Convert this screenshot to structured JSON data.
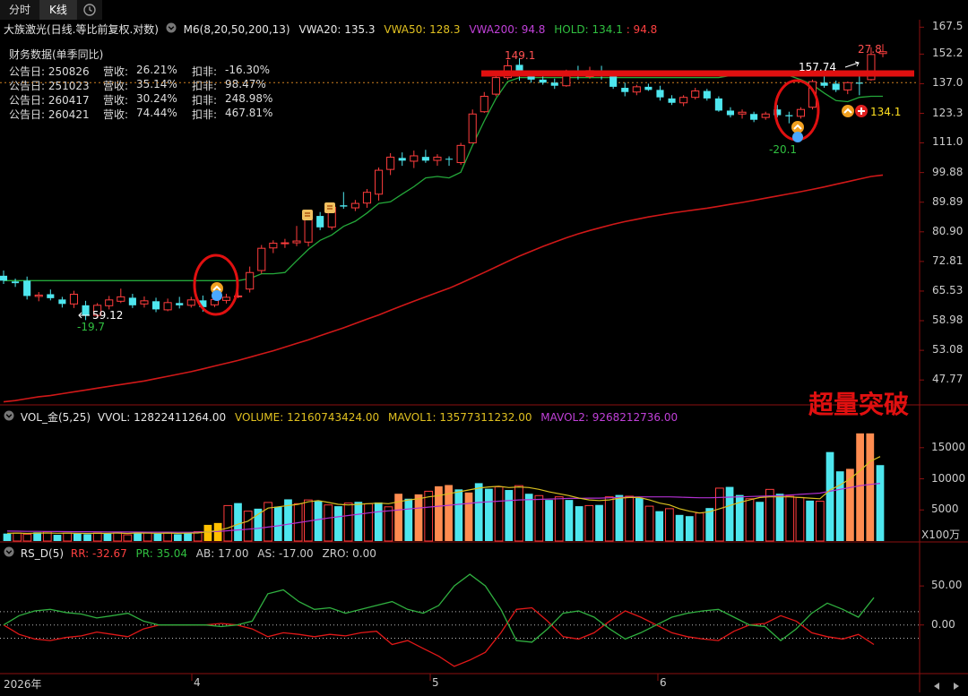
{
  "tabs": [
    {
      "label": "分时",
      "active": false
    },
    {
      "label": "K线",
      "active": true
    }
  ],
  "price_header": {
    "stock": "大族激光(日线.等比前复权.对数)",
    "m6": "M6(8,20,50,200,13)",
    "vwa20": "VWA20: 135.3",
    "vwa50": "VWA50: 128.3",
    "vwa200": "VWA200: 94.8",
    "hold": "HOLD: 134.1",
    "hold2": ": 94.8"
  },
  "financial": {
    "title": "财务数据(单季同比)",
    "rows": [
      {
        "date": "公告日: 250826",
        "rev_label": "营收:",
        "rev": "26.21%",
        "np_label": "扣非:",
        "np": "-16.30%"
      },
      {
        "date": "公告日: 251023",
        "rev_label": "营收:",
        "rev": "35.14%",
        "np_label": "扣非:",
        "np": "98.47%"
      },
      {
        "date": "公告日: 260417",
        "rev_label": "营收:",
        "rev": "30.24%",
        "np_label": "扣非:",
        "np": "248.98%"
      },
      {
        "date": "公告日: 260421",
        "rev_label": "营收:",
        "rev": "74.44%",
        "np_label": "扣非:",
        "np": "467.81%"
      }
    ]
  },
  "price_axis": [
    "167.5",
    "152.2",
    "137.0",
    "123.3",
    "111.0",
    "99.88",
    "89.89",
    "80.90",
    "72.81",
    "65.53",
    "58.98",
    "53.08",
    "47.77"
  ],
  "annotations": {
    "high_price": "149.1",
    "right_high": "157.74",
    "right_pct": "27.8",
    "low_price": "59.12",
    "low_pct": "-19.7",
    "right_low_pct": "-20.1",
    "hold_marker": "134.1",
    "breakout_text": "超量突破"
  },
  "vol_header": {
    "name": "VOL_金(5,25)",
    "vvol": "VVOL: 12822411264.00",
    "volume": "VOLUME: 12160743424.00",
    "mavol1": "MAVOL1: 13577311232.00",
    "mavol2": "MAVOL2: 9268212736.00"
  },
  "vol_axis": [
    "15000",
    "10000",
    "5000"
  ],
  "vol_unit": "X100万",
  "rs_header": {
    "name": "RS_D(5)",
    "rr": "RR: -32.67",
    "pr": "PR: 35.04",
    "ab": "AB: 17.00",
    "as": "AS: -17.00",
    "zro": "ZRO: 0.00"
  },
  "rs_axis": [
    "50.00",
    "0.00"
  ],
  "x_axis": [
    {
      "label": "2026年"
    },
    {
      "label": "4"
    },
    {
      "label": "5"
    },
    {
      "label": "6"
    }
  ],
  "colors": {
    "up": "#ff3d3d",
    "down": "#4ee6ee",
    "ma_green": "#24a83a",
    "ma_red": "#d01818",
    "vol_orange": "#ff8c50",
    "vol_yellow": "#ffc000",
    "mavol1": "#d8c020",
    "mavol2": "#b030d0",
    "annot_red": "#e01010"
  },
  "chart_data": [
    {
      "type": "candlestick",
      "title": "大族激光(日线.等比前复权.对数)",
      "ylim": [
        44,
        172
      ],
      "yscale": "log",
      "candles": [
        [
          69.2,
          70.5,
          67.2,
          68.0
        ],
        [
          67.8,
          68.5,
          66.5,
          67.4
        ],
        [
          68.0,
          69.0,
          63.6,
          64.4
        ],
        [
          64.3,
          65.3,
          63.2,
          64.6
        ],
        [
          64.8,
          65.9,
          63.4,
          63.9
        ],
        [
          63.6,
          64.2,
          61.8,
          62.6
        ],
        [
          62.6,
          65.6,
          61.7,
          64.8
        ],
        [
          62.3,
          63.3,
          59.1,
          60.0
        ],
        [
          60.1,
          62.8,
          59.6,
          62.3
        ],
        [
          62.2,
          64.4,
          61.4,
          63.5
        ],
        [
          63.2,
          66.1,
          62.8,
          64.2
        ],
        [
          64.0,
          64.9,
          61.7,
          62.3
        ],
        [
          62.6,
          64.3,
          61.8,
          63.3
        ],
        [
          63.2,
          64.0,
          60.8,
          61.4
        ],
        [
          61.3,
          63.8,
          61.0,
          62.9
        ],
        [
          62.8,
          64.2,
          61.6,
          62.3
        ],
        [
          62.3,
          64.2,
          61.8,
          63.5
        ],
        [
          63.4,
          64.5,
          60.9,
          61.9
        ],
        [
          62.4,
          63.9,
          61.9,
          63.6
        ],
        [
          63.4,
          64.9,
          62.7,
          64.1
        ],
        [
          64.4,
          65.8,
          63.9,
          64.4
        ],
        [
          66.0,
          71.5,
          65.2,
          70.0
        ],
        [
          70.5,
          77.2,
          69.7,
          76.3
        ],
        [
          76.4,
          78.5,
          75.0,
          77.7
        ],
        [
          77.6,
          78.9,
          76.4,
          77.8
        ],
        [
          77.8,
          82.6,
          76.9,
          78.3
        ],
        [
          78.0,
          85.8,
          76.8,
          84.8
        ],
        [
          85.6,
          86.8,
          81.4,
          82.2
        ],
        [
          82.3,
          89.0,
          81.5,
          88.3
        ],
        [
          88.9,
          93.2,
          87.8,
          88.5
        ],
        [
          88.1,
          90.6,
          87.1,
          89.5
        ],
        [
          89.6,
          94.2,
          88.1,
          93.1
        ],
        [
          92.5,
          101.7,
          90.4,
          100.7
        ],
        [
          101.0,
          107.0,
          99.0,
          105.5
        ],
        [
          105.2,
          107.3,
          102.3,
          104.2
        ],
        [
          104.0,
          108.0,
          101.5,
          106.0
        ],
        [
          105.6,
          108.3,
          103.4,
          104.2
        ],
        [
          104.3,
          106.6,
          102.3,
          105.5
        ],
        [
          104.9,
          105.8,
          102.3,
          104.7
        ],
        [
          103.5,
          111.0,
          102.7,
          110.0
        ],
        [
          111.0,
          125.0,
          111.0,
          123.0
        ],
        [
          124.0,
          133.0,
          123.5,
          131.0
        ],
        [
          132.0,
          142.0,
          131.0,
          140.0
        ],
        [
          140.0,
          149.1,
          139.0,
          146.0
        ],
        [
          146.5,
          150.0,
          138.5,
          141.0
        ],
        [
          140.5,
          143.0,
          137.5,
          139.0
        ],
        [
          139.0,
          141.0,
          136.5,
          137.5
        ],
        [
          137.5,
          139.5,
          134.5,
          136.0
        ],
        [
          136.0,
          144.0,
          135.5,
          142.0
        ],
        [
          142.0,
          146.0,
          139.0,
          141.0
        ],
        [
          140.5,
          145.5,
          139.5,
          143.5
        ],
        [
          143.0,
          146.0,
          139.0,
          140.5
        ],
        [
          140.5,
          142.0,
          134.5,
          135.5
        ],
        [
          135.0,
          137.5,
          131.0,
          133.0
        ],
        [
          133.0,
          136.5,
          131.5,
          135.5
        ],
        [
          135.5,
          137.0,
          133.5,
          134.0
        ],
        [
          134.0,
          136.0,
          129.0,
          130.5
        ],
        [
          130.0,
          131.5,
          127.0,
          128.0
        ],
        [
          128.0,
          131.5,
          126.5,
          130.5
        ],
        [
          130.5,
          135.0,
          129.5,
          133.5
        ],
        [
          133.5,
          134.5,
          129.0,
          130.0
        ],
        [
          130.0,
          131.0,
          124.0,
          124.5
        ],
        [
          124.5,
          126.0,
          121.5,
          122.5
        ],
        [
          123.0,
          125.0,
          121.0,
          123.8
        ],
        [
          123.0,
          124.0,
          119.5,
          120.5
        ],
        [
          121.5,
          124.0,
          120.5,
          123.0
        ],
        [
          125.0,
          127.0,
          121.5,
          122.5
        ],
        [
          122.5,
          124.0,
          119.0,
          122.0
        ],
        [
          122.0,
          126.0,
          121.0,
          125.0
        ],
        [
          126.0,
          139.0,
          125.0,
          138.0
        ],
        [
          137.5,
          141.0,
          135.0,
          136.0
        ],
        [
          137.0,
          138.5,
          133.0,
          134.0
        ],
        [
          134.0,
          138.0,
          132.0,
          137.5
        ],
        [
          137.5,
          142.0,
          131.5,
          137.0
        ],
        [
          139.0,
          156.0,
          138.5,
          152.0
        ],
        [
          152.5,
          157.7,
          150.5,
          153.5
        ]
      ],
      "ma_green": [
        68.0,
        68.0,
        68.0,
        68.0,
        68.0,
        68.0,
        68.0,
        68.0,
        68.0,
        68.0,
        68.0,
        68.0,
        68.0,
        68.0,
        68.0,
        68.0,
        68.0,
        68.0,
        68.0,
        68.0,
        68.0,
        68.5,
        69.7,
        69.7,
        70.0,
        73.0,
        76.0,
        78.5,
        80.0,
        82.5,
        84.0,
        86.5,
        89.5,
        90.0,
        92.5,
        95.0,
        98.0,
        98.5,
        98.0,
        100.0,
        110.0,
        120.0,
        130.0,
        138.0,
        140.0,
        140.0,
        140.0,
        140.0,
        140.0,
        140.0,
        140.0,
        140.0,
        140.0,
        140.0,
        140.0,
        140.0,
        140.0,
        140.0,
        140.0,
        140.0,
        140.0,
        140.0,
        141.0,
        141.0,
        141.0,
        141.0,
        141.0,
        141.0,
        139.0,
        136.5,
        132.5,
        129.0,
        128.5,
        130.5,
        131.0,
        131.0
      ],
      "ma_red": [
        44.2,
        44.4,
        44.7,
        45.0,
        45.2,
        45.5,
        45.8,
        46.1,
        46.4,
        46.7,
        47.0,
        47.3,
        47.6,
        48.0,
        48.4,
        48.8,
        49.2,
        49.7,
        50.2,
        50.7,
        51.2,
        51.8,
        52.4,
        53.0,
        53.7,
        54.4,
        55.1,
        55.9,
        56.7,
        57.5,
        58.4,
        59.3,
        60.2,
        61.2,
        62.2,
        63.2,
        64.2,
        65.2,
        66.2,
        67.4,
        68.7,
        70.0,
        71.4,
        72.8,
        74.2,
        75.5,
        76.8,
        78.0,
        79.2,
        80.3,
        81.3,
        82.2,
        83.1,
        83.9,
        84.6,
        85.3,
        85.9,
        86.5,
        87.0,
        87.5,
        88.0,
        88.6,
        89.2,
        89.8,
        90.5,
        91.2,
        91.9,
        92.6,
        93.3,
        94.1,
        94.9,
        95.8,
        96.7,
        97.6,
        98.5,
        99.0
      ]
    },
    {
      "type": "bar",
      "title": "VOL_金(5,25)",
      "ylim": [
        0,
        19000
      ],
      "values": [
        1200,
        1300,
        1100,
        1400,
        1500,
        1000,
        1300,
        1200,
        1100,
        1300,
        1200,
        1400,
        1000,
        1500,
        1300,
        1200,
        1400,
        1100,
        1300,
        1500,
        2600,
        2900,
        5700,
        6100,
        4800,
        5200,
        6200,
        5500,
        6700,
        6000,
        6600,
        6400,
        5800,
        5600,
        6100,
        6300,
        6000,
        6200,
        5500,
        7600,
        6800,
        7500,
        8000,
        8800,
        9000,
        8300,
        7800,
        9300,
        8400,
        8700,
        8200,
        8900,
        7600,
        7300,
        6600,
        7100,
        6600,
        5600,
        5700,
        5800,
        7100,
        7400,
        7200,
        6900,
        5600,
        4800,
        5200,
        4200,
        4000,
        4500,
        5300,
        8500,
        8700,
        7400,
        6800,
        6300,
        8300,
        7600,
        7200,
        7000,
        6500,
        6400,
        14300,
        11200,
        11600,
        17300,
        17300,
        12200
      ],
      "mavol1": [
        1250,
        1280,
        1230,
        1280,
        1300,
        1250,
        1280,
        1240,
        1220,
        1250,
        1240,
        1280,
        1220,
        1300,
        1260,
        1250,
        1280,
        1240,
        1260,
        1300,
        1500,
        1700,
        2100,
        2700,
        3200,
        4300,
        5300,
        5500,
        5700,
        5900,
        6300,
        6500,
        6200,
        5900,
        5800,
        5900,
        6000,
        6100,
        6000,
        6300,
        6600,
        6800,
        7100,
        7300,
        7600,
        7900,
        8200,
        8500,
        8700,
        8800,
        8600,
        8700,
        8600,
        8300,
        7900,
        7600,
        7300,
        6900,
        6600,
        6500,
        6600,
        6900,
        7000,
        7000,
        6600,
        6100,
        5800,
        5200,
        4800,
        4500,
        4700,
        5200,
        5700,
        6200,
        6600,
        7000,
        7100,
        7100,
        7100,
        7000,
        6900,
        6800,
        8200,
        9000,
        10000,
        11300,
        12800,
        13577
      ],
      "mavol2": [
        1600,
        1580,
        1560,
        1550,
        1540,
        1520,
        1510,
        1500,
        1490,
        1480,
        1470,
        1460,
        1450,
        1440,
        1430,
        1420,
        1420,
        1410,
        1410,
        1420,
        1480,
        1540,
        1650,
        1780,
        1900,
        2050,
        2250,
        2450,
        2700,
        2950,
        3200,
        3450,
        3700,
        3900,
        4100,
        4300,
        4500,
        4700,
        4850,
        5000,
        5150,
        5300,
        5450,
        5600,
        5750,
        5900,
        6050,
        6200,
        6300,
        6400,
        6500,
        6600,
        6650,
        6700,
        6750,
        6800,
        6850,
        6850,
        6900,
        6900,
        6950,
        7000,
        7050,
        7100,
        7100,
        7100,
        7100,
        7050,
        7000,
        6950,
        6950,
        7000,
        7050,
        7100,
        7150,
        7200,
        7250,
        7300,
        7400,
        7500,
        7600,
        7700,
        8000,
        8300,
        8600,
        8900,
        9100,
        9268
      ],
      "colors": [
        "down",
        "up",
        "up",
        "down",
        "up",
        "down",
        "up",
        "down",
        "down",
        "up",
        "down",
        "up",
        "up",
        "down",
        "up",
        "down",
        "up",
        "down",
        "down",
        "up",
        "yellow",
        "yellow",
        "up",
        "down",
        "up",
        "down",
        "up",
        "down",
        "down",
        "up",
        "up",
        "down",
        "up",
        "down",
        "up",
        "down",
        "up",
        "down",
        "up",
        "orange",
        "down",
        "orange",
        "up",
        "orange",
        "orange",
        "down",
        "orange",
        "down",
        "down",
        "up",
        "down",
        "up",
        "down",
        "up",
        "down",
        "up",
        "down",
        "down",
        "up",
        "down",
        "up",
        "down",
        "up",
        "down",
        "up",
        "down",
        "up",
        "down",
        "down",
        "up",
        "down",
        "up",
        "down",
        "down",
        "up",
        "down",
        "up",
        "down",
        "up",
        "up",
        "down",
        "up",
        "down",
        "down",
        "orange",
        "orange",
        "orange",
        "down"
      ]
    },
    {
      "type": "line",
      "title": "RS_D(5)",
      "ylim": [
        -60,
        80
      ],
      "series": [
        {
          "name": "RR",
          "values": [
            0,
            -12,
            -18,
            -20,
            -16,
            -14,
            -9,
            -12,
            -15,
            -5,
            0,
            0,
            0,
            0,
            2,
            0,
            -5,
            -15,
            -10,
            -12,
            -15,
            -12,
            -14,
            -10,
            -8,
            -25,
            -20,
            -30,
            -40,
            -53,
            -45,
            -35,
            -10,
            20,
            22,
            5,
            -15,
            -18,
            -10,
            5,
            18,
            10,
            0,
            -10,
            -15,
            -18,
            -20,
            -8,
            0,
            2,
            12,
            5,
            -10,
            -15,
            -18,
            -12,
            -25
          ]
        },
        {
          "name": "PR",
          "values": [
            0,
            12,
            18,
            20,
            16,
            14,
            9,
            12,
            15,
            5,
            0,
            0,
            0,
            0,
            -2,
            0,
            5,
            40,
            45,
            30,
            20,
            22,
            15,
            20,
            25,
            30,
            20,
            15,
            25,
            50,
            65,
            50,
            20,
            -20,
            -22,
            -5,
            15,
            18,
            10,
            -5,
            -18,
            -10,
            0,
            10,
            15,
            18,
            20,
            10,
            0,
            -2,
            -20,
            -5,
            15,
            28,
            20,
            10,
            35
          ]
        }
      ]
    }
  ]
}
